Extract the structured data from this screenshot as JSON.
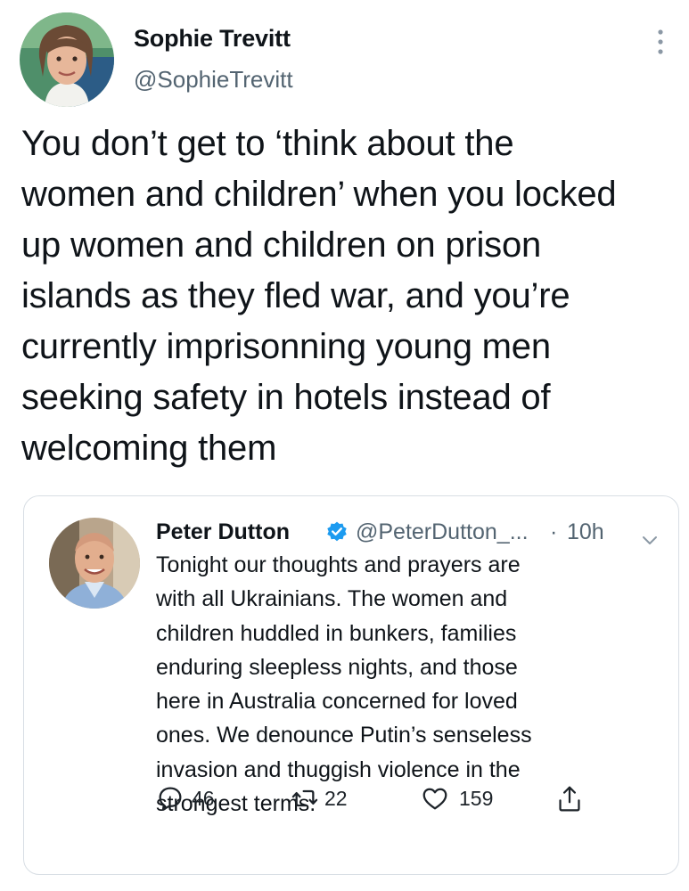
{
  "tweet": {
    "author_name": "Sophie Trevitt",
    "author_handle": "@SophieTrevitt",
    "text": "You don’t get to ‘think about the\nwomen and children’ when you locked\nup women and children on prison\nislands as they fled war, and you’re\ncurrently imprisonning young men\nseeking safety in hotels instead of\nwelcoming them"
  },
  "quoted": {
    "author_name": "Peter Dutton",
    "author_handle": "@PeterDutton_...",
    "separator": "·",
    "time": "10h",
    "text": "Tonight our thoughts and prayers are\nwith all Ukrainians. The women and\nchildren huddled in bunkers, families\nenduring sleepless nights, and those\nhere in Australia concerned for loved\nones. We denounce Putin’s senseless\ninvasion and thuggish violence in the\nstrongest terms.",
    "actions": {
      "replies": "46",
      "retweets": "22",
      "likes": "159"
    }
  },
  "icons": {
    "more": "more-vertical-icon",
    "verified": "verified-badge-icon",
    "chevron": "chevron-down-icon",
    "reply": "reply-icon",
    "retweet": "retweet-icon",
    "like": "heart-icon",
    "share": "share-icon"
  },
  "colors": {
    "text": "#0f1419",
    "secondary": "#536471",
    "verified": "#1d9bf0",
    "border": "#d8dee4"
  }
}
